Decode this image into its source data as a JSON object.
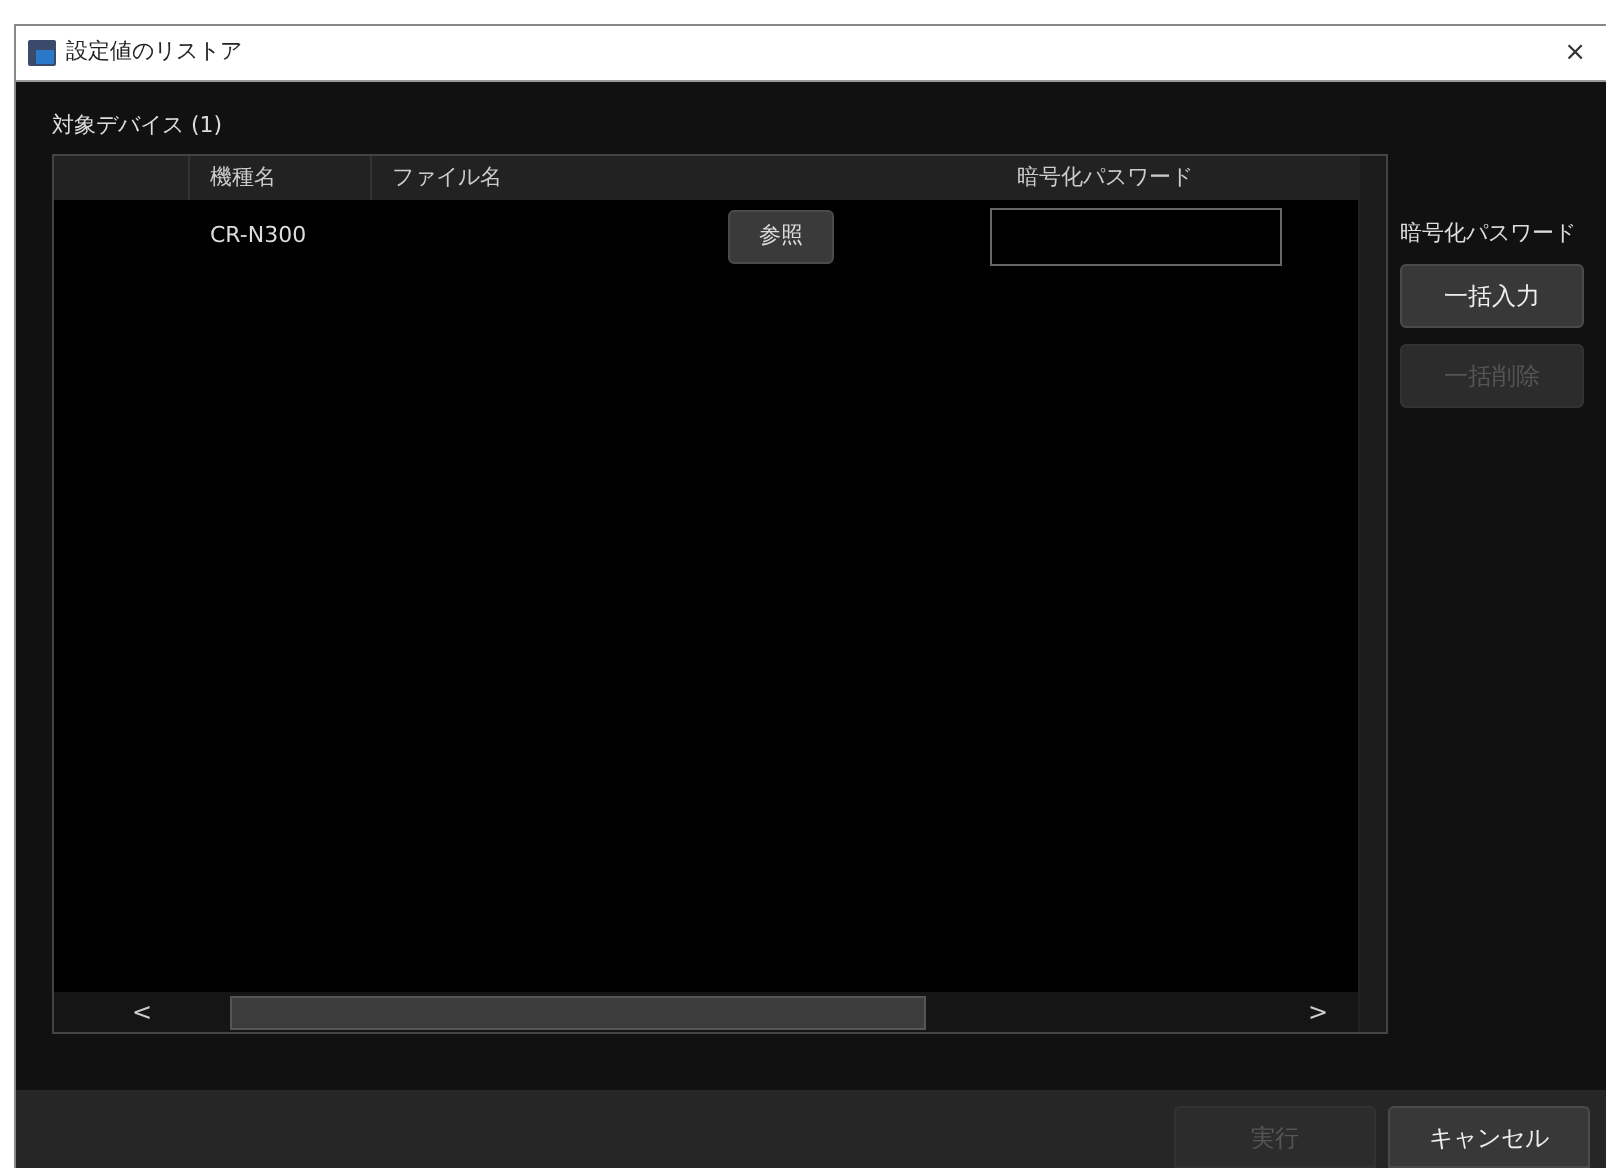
{
  "window": {
    "title": "設定値のリストア",
    "close": "×"
  },
  "section_title": "対象デバイス (1)",
  "table": {
    "columns": [
      "機種名",
      "ファイル名",
      "暗号化パスワード"
    ],
    "rows": [
      {
        "model": "CR-N300",
        "browse_button": "参照",
        "password": ""
      }
    ],
    "scroll_left": "<",
    "scroll_right": ">"
  },
  "side_panel": {
    "title": "暗号化パスワード",
    "buttons": [
      {
        "label": "一括入力",
        "disabled": false
      },
      {
        "label": "一括削除",
        "disabled": true
      }
    ]
  },
  "footer_buttons": [
    {
      "label": "実行",
      "disabled": true
    },
    {
      "label": "キャンセル",
      "disabled": false
    }
  ]
}
